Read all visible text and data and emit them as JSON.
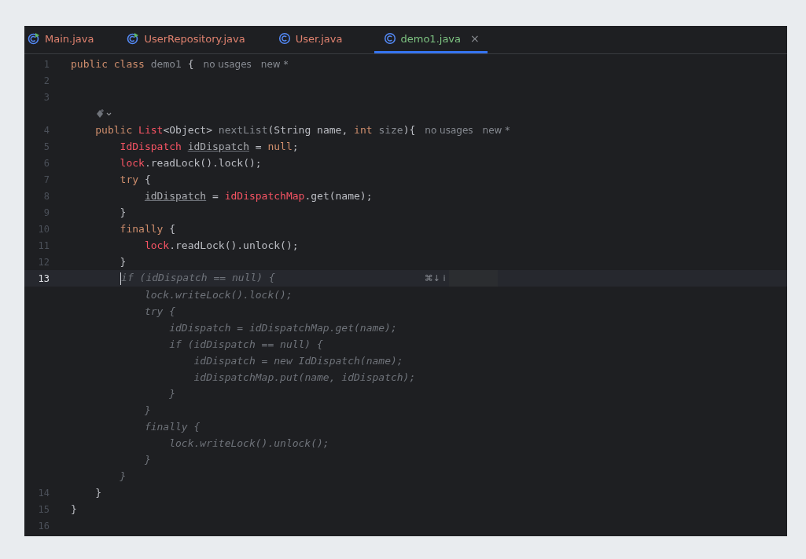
{
  "tabs": [
    {
      "label": "Main.java",
      "kind": "runnable",
      "color": "#e0826f",
      "selected": false
    },
    {
      "label": "UserRepository.java",
      "kind": "runnable",
      "color": "#e0826f",
      "selected": false
    },
    {
      "label": "User.java",
      "kind": "class",
      "color": "#e0826f",
      "selected": false
    },
    {
      "label": "demo1.java",
      "kind": "class",
      "color": "#7ec482",
      "selected": true,
      "close": "×"
    }
  ],
  "lines": [
    {
      "kind": "code",
      "number": "1",
      "current": false,
      "tokens": [
        {
          "t": "public class ",
          "kind": "keyword"
        },
        {
          "t": "demo1",
          "kind": "unused"
        },
        {
          "t": " {",
          "kind": "plain"
        }
      ],
      "hints": [
        "no usages",
        "new *"
      ]
    },
    {
      "kind": "code",
      "number": "2",
      "current": false
    },
    {
      "kind": "code",
      "number": "3",
      "current": false
    },
    {
      "kind": "ai"
    },
    {
      "kind": "code",
      "number": "4",
      "current": false,
      "tokens": [
        {
          "t": "public ",
          "kind": "keyword"
        },
        {
          "t": "List",
          "kind": "type"
        },
        {
          "t": "<Object> ",
          "kind": "plain"
        },
        {
          "t": "nextList",
          "kind": "unused"
        },
        {
          "t": "(String name, ",
          "kind": "plain"
        },
        {
          "t": "int ",
          "kind": "keyword"
        },
        {
          "t": "size",
          "kind": "unused"
        },
        {
          "t": "){",
          "kind": "plain"
        }
      ],
      "hints": [
        "no usages",
        "new *"
      ]
    },
    {
      "kind": "code",
      "number": "5",
      "current": false,
      "tokens": [
        {
          "t": "IdDispatch ",
          "kind": "type"
        },
        {
          "t": "idDispatch",
          "kind": "local"
        },
        {
          "t": " = ",
          "kind": "plain"
        },
        {
          "t": "null",
          "kind": "keyword"
        },
        {
          "t": ";",
          "kind": "plain"
        }
      ]
    },
    {
      "kind": "code",
      "number": "6",
      "current": false,
      "tokens": [
        {
          "t": "lock",
          "kind": "type"
        },
        {
          "t": ".readLock().lock();",
          "kind": "plain"
        }
      ]
    },
    {
      "kind": "code",
      "number": "7",
      "current": false,
      "tokens": [
        {
          "t": "try",
          "kind": "keyword"
        },
        {
          "t": " {",
          "kind": "plain"
        }
      ]
    },
    {
      "kind": "code",
      "number": "8",
      "current": false,
      "tokens": [
        {
          "t": "idDispatch",
          "kind": "local"
        },
        {
          "t": " = ",
          "kind": "plain"
        },
        {
          "t": "idDispatchMap",
          "kind": "type"
        },
        {
          "t": ".get(name);",
          "kind": "plain"
        }
      ]
    },
    {
      "kind": "code",
      "number": "9",
      "current": false,
      "tokens": [
        {
          "t": "}",
          "kind": "plain"
        }
      ]
    },
    {
      "kind": "code",
      "number": "10",
      "current": false,
      "tokens": [
        {
          "t": "finally",
          "kind": "keyword"
        },
        {
          "t": " {",
          "kind": "plain"
        }
      ]
    },
    {
      "kind": "code",
      "number": "11",
      "current": false,
      "tokens": [
        {
          "t": "lock",
          "kind": "type"
        },
        {
          "t": ".readLock().unlock();",
          "kind": "plain"
        }
      ]
    },
    {
      "kind": "code",
      "number": "12",
      "current": false,
      "tokens": [
        {
          "t": "}",
          "kind": "plain"
        }
      ]
    },
    {
      "kind": "code",
      "number": "13",
      "current": true,
      "tokens": [
        {
          "t": "if (idDispatch == null) {",
          "kind": "ghost"
        }
      ],
      "shortcut": "⌘↓ i",
      "redacted": true
    },
    {
      "kind": "ghost",
      "text": "lock.writeLock().lock();"
    },
    {
      "kind": "ghost",
      "text": "try {"
    },
    {
      "kind": "ghost",
      "text": "idDispatch = idDispatchMap.get(name);"
    },
    {
      "kind": "ghost",
      "text": "if (idDispatch == null) {"
    },
    {
      "kind": "ghost",
      "text": "idDispatch = new IdDispatch(name);"
    },
    {
      "kind": "ghost",
      "text": "idDispatchMap.put(name, idDispatch);"
    },
    {
      "kind": "ghost",
      "text": "}"
    },
    {
      "kind": "ghost",
      "text": "}"
    },
    {
      "kind": "ghost",
      "text": "finally {"
    },
    {
      "kind": "ghost",
      "text": "lock.writeLock().unlock();"
    },
    {
      "kind": "ghost",
      "text": "}"
    },
    {
      "kind": "ghost",
      "text": "}"
    },
    {
      "kind": "code",
      "number": "14",
      "current": false,
      "tokens": [
        {
          "t": "}",
          "kind": "plain"
        }
      ]
    },
    {
      "kind": "code",
      "number": "15",
      "current": false,
      "tokens": [
        {
          "t": "}",
          "kind": "plain"
        }
      ]
    },
    {
      "kind": "code",
      "number": "16",
      "current": false
    }
  ]
}
